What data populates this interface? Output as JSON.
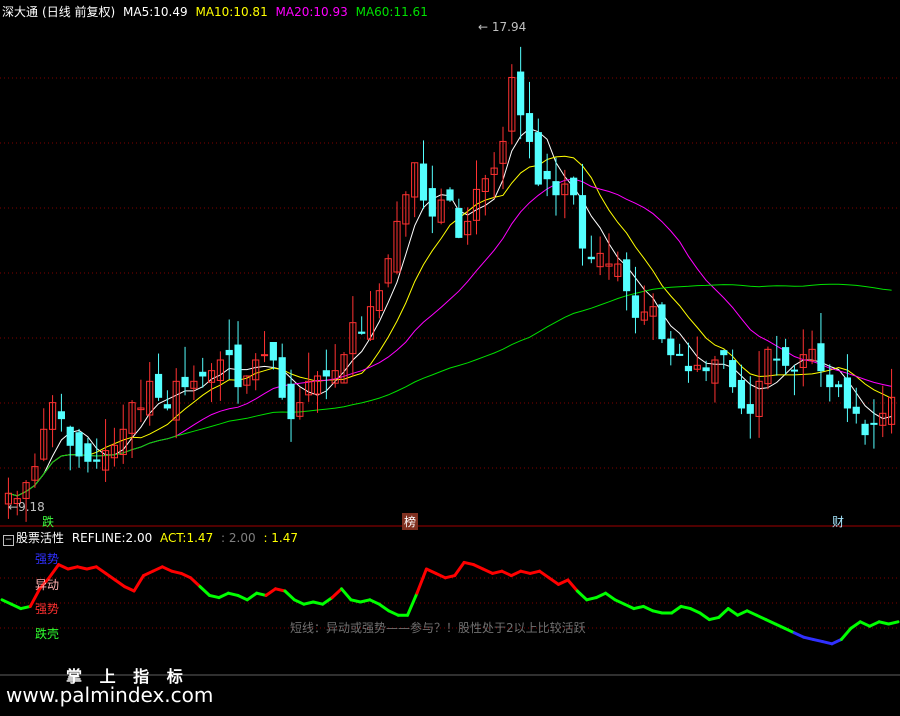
{
  "top_header": {
    "stock": "深大通",
    "mode": "(日线 前复权)",
    "ma5_label": "MA5:",
    "ma5_value": "10.49",
    "ma10_label": "MA10:",
    "ma10_value": "10.81",
    "ma20_label": "MA20:",
    "ma20_value": "10.93",
    "ma60_label": "MA60:",
    "ma60_value": "11.61"
  },
  "price_annotations": {
    "high": "17.94",
    "low": "9.18",
    "high_arrow": "←",
    "low_arrow": "←"
  },
  "event_markers": [
    {
      "text": "跌",
      "color": "#40ff40"
    },
    {
      "text": "榜",
      "color": "#ffffff"
    },
    {
      "text": "财",
      "color": "#a8e8ff"
    }
  ],
  "bottom_header": {
    "expand_icon": "minus-box-icon",
    "indicator": "股票活性",
    "refline_label": "REFLINE:",
    "refline_value": "2.00",
    "act_label": "ACT:",
    "act_value": "1.47",
    "extra1": ": 2.00",
    "extra2": ": 1.47"
  },
  "indicator_labels": {
    "strong_momentum": "强势",
    "anomaly": "异动",
    "strong": "强势",
    "shell": "跌壳"
  },
  "comment": "短线：异动或强势——参与？！股性处于2以上比较活跃",
  "watermark": {
    "title": "掌 上 指 标",
    "url": "www.palmindex.com"
  },
  "colors": {
    "up": "#ff3232",
    "down": "#54ffff",
    "ma5": "#ffffff",
    "ma10": "#ffff00",
    "ma20": "#ff00ff",
    "ma60": "#00e000",
    "grid": "#800000",
    "act_red": "#ff0000",
    "act_green": "#00ff00",
    "act_blue": "#3030ff",
    "act_yellow": "#ffff00"
  },
  "chart_data": [
    {
      "type": "candlestick",
      "title": "深大通 日线 前复权",
      "price_range": [
        9.18,
        17.94
      ],
      "series": [
        {
          "name": "MA5",
          "last": 10.49
        },
        {
          "name": "MA10",
          "last": 10.81
        },
        {
          "name": "MA20",
          "last": 10.93
        },
        {
          "name": "MA60",
          "last": 11.61
        }
      ],
      "close": [
        9.4,
        9.3,
        9.6,
        9.9,
        10.6,
        11.1,
        10.8,
        10.3,
        10.1,
        10.0,
        10.0,
        10.2,
        10.3,
        10.6,
        11.1,
        11.0,
        11.5,
        11.2,
        11.0,
        11.5,
        11.4,
        11.5,
        11.6,
        11.7,
        11.9,
        12.0,
        11.4,
        11.6,
        11.9,
        12.0,
        11.9,
        11.2,
        10.8,
        11.1,
        11.5,
        11.6,
        11.6,
        11.7,
        12.0,
        12.6,
        12.4,
        12.9,
        13.2,
        13.8,
        14.5,
        15.0,
        15.6,
        14.9,
        14.6,
        14.9,
        14.9,
        14.2,
        14.5,
        15.1,
        15.3,
        15.5,
        16.0,
        17.2,
        16.5,
        16.0,
        15.2,
        15.3,
        15.0,
        15.2,
        15.0,
        14.0,
        13.8,
        13.9,
        13.7,
        13.7,
        13.2,
        12.7,
        12.8,
        12.9,
        12.3,
        12.0,
        12.0,
        11.7,
        11.8,
        11.7,
        11.9,
        12.0,
        11.4,
        11.0,
        10.9,
        11.5,
        12.1,
        11.9,
        11.8,
        11.7,
        12.0,
        12.1,
        11.7,
        11.4,
        11.4,
        11.0,
        10.9,
        10.5,
        10.7,
        10.9,
        11.2
      ],
      "volatility_note": "approximate reconstruction of ~100 daily bars"
    },
    {
      "type": "line",
      "title": "股票活性",
      "series": [
        {
          "name": "REFLINE",
          "values": [
            2.0
          ]
        },
        {
          "name": "ACT",
          "last": 1.47,
          "values": [
            1.6,
            1.4,
            1.2,
            1.3,
            2.1,
            2.6,
            3.2,
            3.0,
            3.1,
            3.0,
            3.1,
            2.8,
            2.5,
            2.2,
            2.0,
            2.7,
            2.9,
            3.1,
            2.9,
            2.8,
            2.6,
            2.2,
            1.8,
            1.7,
            1.9,
            1.8,
            1.6,
            1.9,
            1.8,
            2.1,
            2.0,
            1.6,
            1.4,
            1.5,
            1.4,
            1.7,
            2.1,
            1.6,
            1.5,
            1.6,
            1.4,
            1.1,
            0.9,
            0.9,
            1.9,
            3.0,
            2.8,
            2.6,
            2.7,
            3.3,
            3.2,
            3.0,
            2.8,
            2.9,
            2.7,
            2.9,
            2.8,
            2.9,
            2.6,
            2.3,
            2.5,
            2.0,
            1.6,
            1.7,
            1.9,
            1.6,
            1.4,
            1.2,
            1.3,
            1.1,
            1.0,
            1.0,
            1.3,
            1.2,
            1.0,
            0.7,
            0.8,
            1.2,
            0.9,
            1.1,
            0.9,
            0.7,
            0.5,
            0.3,
            0.1,
            -0.1,
            -0.2,
            -0.3,
            -0.4,
            -0.2,
            0.3,
            0.6,
            0.4,
            0.6,
            0.5,
            0.6
          ]
        }
      ]
    }
  ]
}
